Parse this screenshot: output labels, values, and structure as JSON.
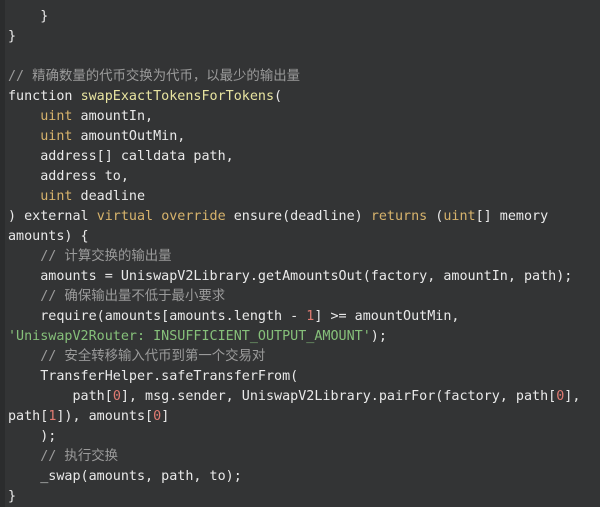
{
  "editor": {
    "language": "solidity",
    "background_color": "#333435",
    "gutter_color": "#2b2c2d",
    "default_text_color": "#e9e9e9",
    "theme": "dark"
  },
  "palette": {
    "plain": "#e9e9e9",
    "comment": "#9b9b9b",
    "keyword": "#d7b36c",
    "function": "#e8e4a0",
    "string": "#86c07a",
    "number": "#e07b72"
  },
  "code": {
    "lines": [
      {
        "id": 1,
        "tokens": [
          {
            "t": "    }",
            "c": "plain"
          }
        ]
      },
      {
        "id": 2,
        "tokens": [
          {
            "t": "}",
            "c": "plain"
          }
        ]
      },
      {
        "id": 3,
        "tokens": [
          {
            "t": "",
            "c": "plain"
          }
        ]
      },
      {
        "id": 4,
        "tokens": [
          {
            "t": "// 精确数量的代币交换为代币，以最少的输出量",
            "c": "comment"
          }
        ]
      },
      {
        "id": 5,
        "tokens": [
          {
            "t": "function ",
            "c": "plain"
          },
          {
            "t": "swapExactTokensForTokens",
            "c": "function"
          },
          {
            "t": "(",
            "c": "plain"
          }
        ]
      },
      {
        "id": 6,
        "tokens": [
          {
            "t": "    ",
            "c": "plain"
          },
          {
            "t": "uint",
            "c": "keyword"
          },
          {
            "t": " amountIn,",
            "c": "plain"
          }
        ]
      },
      {
        "id": 7,
        "tokens": [
          {
            "t": "    ",
            "c": "plain"
          },
          {
            "t": "uint",
            "c": "keyword"
          },
          {
            "t": " amountOutMin,",
            "c": "plain"
          }
        ]
      },
      {
        "id": 8,
        "tokens": [
          {
            "t": "    address[] calldata path,",
            "c": "plain"
          }
        ]
      },
      {
        "id": 9,
        "tokens": [
          {
            "t": "    address to,",
            "c": "plain"
          }
        ]
      },
      {
        "id": 10,
        "tokens": [
          {
            "t": "    ",
            "c": "plain"
          },
          {
            "t": "uint",
            "c": "keyword"
          },
          {
            "t": " deadline",
            "c": "plain"
          }
        ]
      },
      {
        "id": 11,
        "tokens": [
          {
            "t": ") external ",
            "c": "plain"
          },
          {
            "t": "virtual",
            "c": "keyword"
          },
          {
            "t": " ",
            "c": "plain"
          },
          {
            "t": "override",
            "c": "keyword"
          },
          {
            "t": " ensure(deadline) ",
            "c": "plain"
          },
          {
            "t": "returns",
            "c": "keyword"
          },
          {
            "t": " (",
            "c": "plain"
          },
          {
            "t": "uint",
            "c": "keyword"
          },
          {
            "t": "[] memory",
            "c": "plain"
          }
        ]
      },
      {
        "id": 12,
        "tokens": [
          {
            "t": "amounts) {",
            "c": "plain"
          }
        ]
      },
      {
        "id": 13,
        "tokens": [
          {
            "t": "    // 计算交换的输出量",
            "c": "comment"
          }
        ]
      },
      {
        "id": 14,
        "tokens": [
          {
            "t": "    amounts = UniswapV2Library.getAmountsOut(factory, amountIn, path);",
            "c": "plain"
          }
        ]
      },
      {
        "id": 15,
        "tokens": [
          {
            "t": "    // 确保输出量不低于最小要求",
            "c": "comment"
          }
        ]
      },
      {
        "id": 16,
        "tokens": [
          {
            "t": "    require(amounts[amounts.length - ",
            "c": "plain"
          },
          {
            "t": "1",
            "c": "number"
          },
          {
            "t": "] >= amountOutMin,",
            "c": "plain"
          }
        ]
      },
      {
        "id": 17,
        "tokens": [
          {
            "t": "'UniswapV2Router: INSUFFICIENT_OUTPUT_AMOUNT'",
            "c": "string"
          },
          {
            "t": ");",
            "c": "plain"
          }
        ]
      },
      {
        "id": 18,
        "tokens": [
          {
            "t": "    // 安全转移输入代币到第一个交易对",
            "c": "comment"
          }
        ]
      },
      {
        "id": 19,
        "tokens": [
          {
            "t": "    TransferHelper.safeTransferFrom(",
            "c": "plain"
          }
        ]
      },
      {
        "id": 20,
        "tokens": [
          {
            "t": "        path[",
            "c": "plain"
          },
          {
            "t": "0",
            "c": "number"
          },
          {
            "t": "], msg.sender, UniswapV2Library.pairFor(factory, path[",
            "c": "plain"
          },
          {
            "t": "0",
            "c": "number"
          },
          {
            "t": "],",
            "c": "plain"
          }
        ]
      },
      {
        "id": 21,
        "tokens": [
          {
            "t": "path[",
            "c": "plain"
          },
          {
            "t": "1",
            "c": "number"
          },
          {
            "t": "]), amounts[",
            "c": "plain"
          },
          {
            "t": "0",
            "c": "number"
          },
          {
            "t": "]",
            "c": "plain"
          }
        ]
      },
      {
        "id": 22,
        "tokens": [
          {
            "t": "    );",
            "c": "plain"
          }
        ]
      },
      {
        "id": 23,
        "tokens": [
          {
            "t": "    // 执行交换",
            "c": "comment"
          }
        ]
      },
      {
        "id": 24,
        "tokens": [
          {
            "t": "    _swap(amounts, path, to);",
            "c": "plain"
          }
        ]
      },
      {
        "id": 25,
        "tokens": [
          {
            "t": "}",
            "c": "plain"
          }
        ]
      }
    ]
  }
}
